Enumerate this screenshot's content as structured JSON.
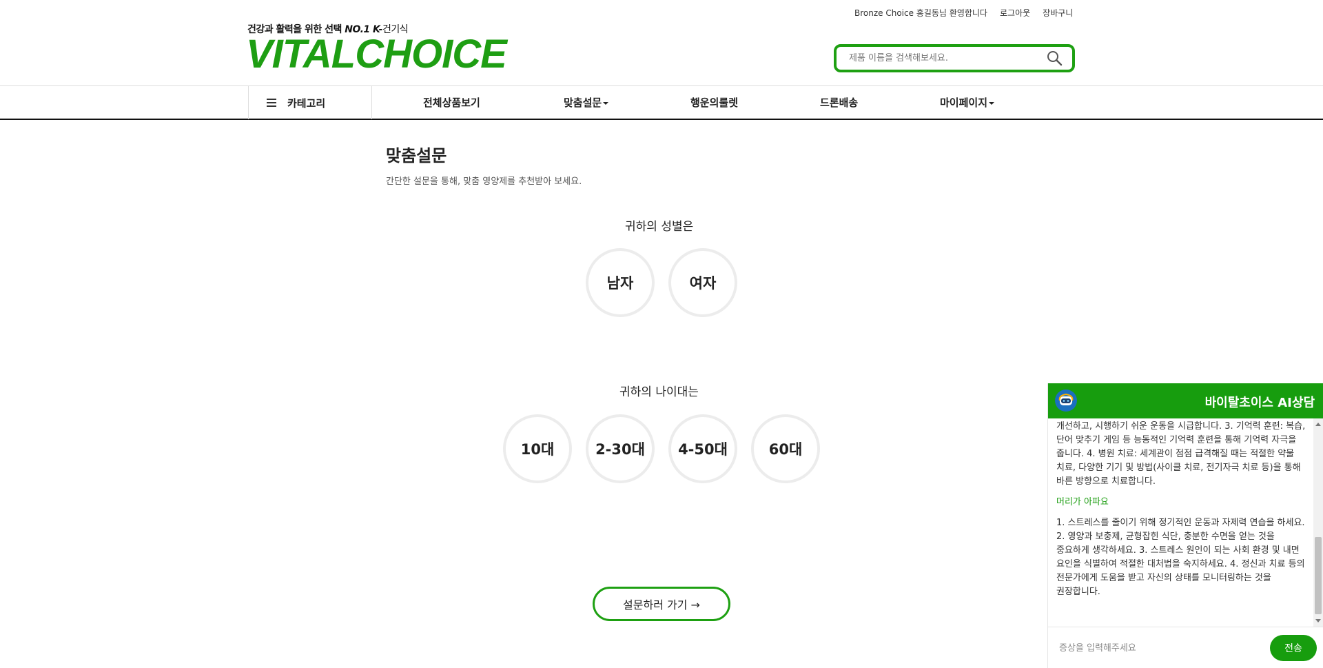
{
  "header": {
    "welcome": "Bronze Choice 홍길동님 환영합니다",
    "logout": "로그아웃",
    "cart": "장바구니",
    "tagline_main": "건강과 활력을 위한 선택 ",
    "tagline_no1": "NO.1 K-",
    "tagline_tail": "건기식",
    "logo_text": "VITALCHOICE",
    "search_placeholder": "제품 이름을 검색해보세요.",
    "search_value": ""
  },
  "nav": {
    "category": "카테고리",
    "items": [
      "전체상품보기",
      "맞춤설문",
      "행운의룰렛",
      "드론배송",
      "마이페이지"
    ]
  },
  "main": {
    "title": "맞춤설문",
    "desc": "간단한 설문을 통해, 맞춤 영양제를 추천받아 보세요.",
    "gender_question": "귀하의 성별은",
    "gender_options": [
      "남자",
      "여자"
    ],
    "age_question": "귀하의 나이대는",
    "age_options": [
      "10대",
      "2-30대",
      "4-50대",
      "60대"
    ],
    "survey_button": "설문하러 가기 →"
  },
  "chat": {
    "title": "바이탈초이스 AI상담",
    "messages": [
      {
        "type": "answer",
        "text": "개선하고, 시행하기 쉬운 운동을 시급합니다. 3. 기억력 훈련: 복습, 단어 맞추기 게임 등 능동적인 기억력 훈련을 통해 기억력 자극을 줍니다. 4. 병원 치료: 세계관이 점점 급격해질 때는 적절한 약물 치료, 다양한 기기 및 방법(사이클 치료, 전기자극 치료 등)을 통해 바른 방향으로 치료합니다."
      },
      {
        "type": "question",
        "text": "머리가 아파요"
      },
      {
        "type": "answer",
        "text": "1. 스트레스를 줄이기 위해 정기적인 운동과 자제력 연습을 하세요. 2. 영양과 보충제, 균형잡힌 식단, 충분한 수면을 얻는 것을 중요하게 생각하세요. 3. 스트레스 원인이 되는 사회 환경 및 내면 요인을 식별하여 적절한 대처법을 숙지하세요. 4. 정신과 치료 등의 전문가에게 도움을 받고 자신의 상태를 모니터링하는 것을 권장합니다."
      }
    ],
    "input_placeholder": "증상을 입력해주세요",
    "send_label": "전송"
  },
  "colors": {
    "brand_green": "#1ea012",
    "chat_header_green": "#179d0e"
  }
}
